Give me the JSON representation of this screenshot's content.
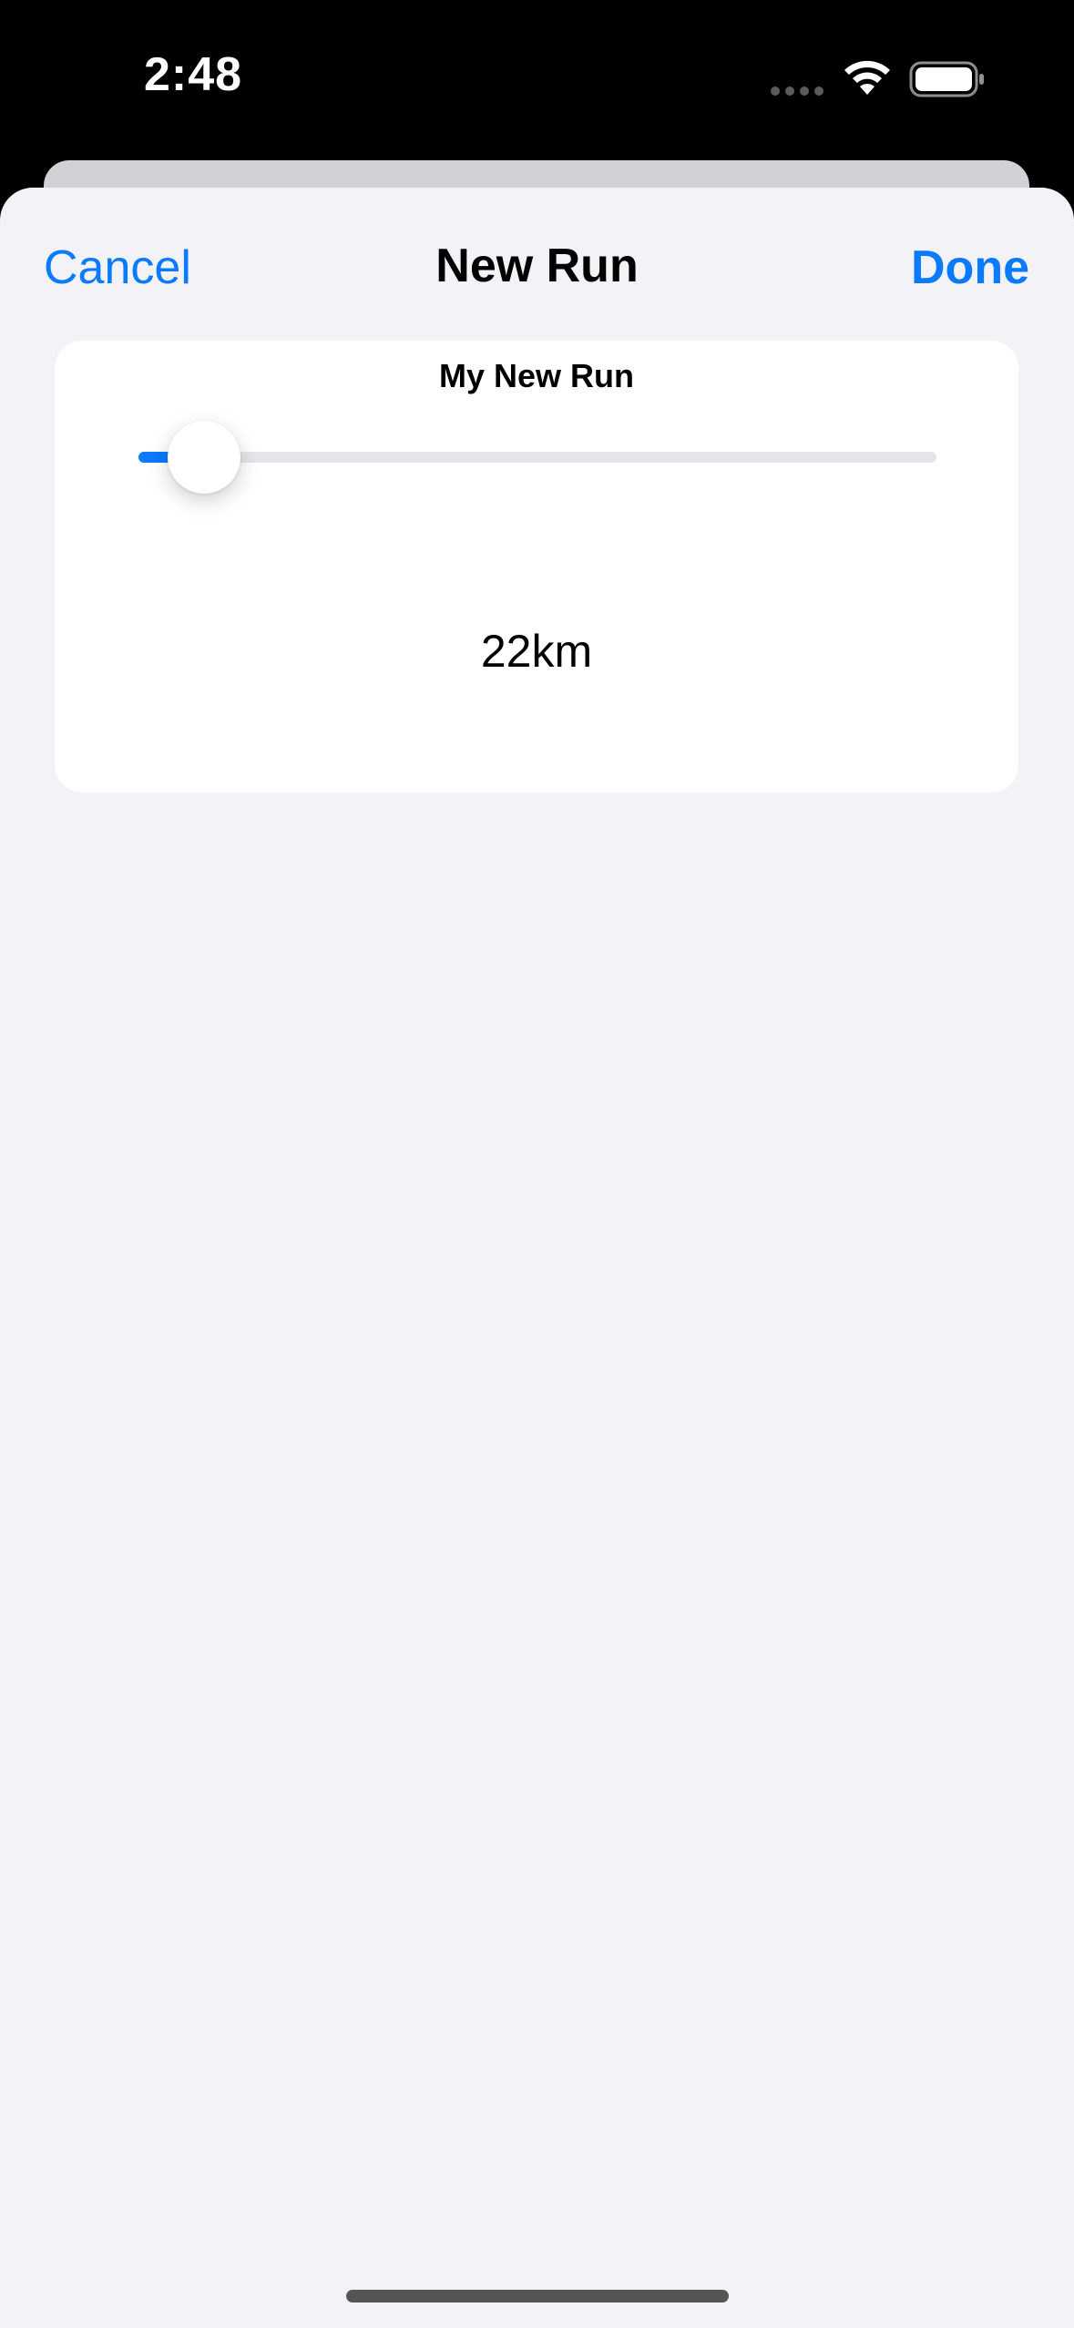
{
  "status_bar": {
    "time": "2:48"
  },
  "nav": {
    "cancel_label": "Cancel",
    "title": "New Run",
    "done_label": "Done"
  },
  "run_card": {
    "title": "My New Run",
    "distance_label": "22km",
    "slider_fraction": 0.04
  },
  "colors": {
    "accent": "#0a7aff",
    "sheet_background": "#f2f2f7",
    "card_background": "#ffffff",
    "track": "#e5e5ea"
  },
  "icons": [
    "cellular-signal-icon",
    "wifi-icon",
    "battery-icon"
  ]
}
